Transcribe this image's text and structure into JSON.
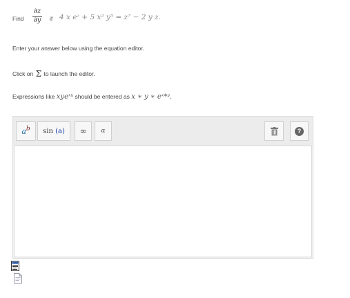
{
  "question": {
    "find_label": "Find",
    "derivative_numerator": "∂z",
    "derivative_denominator": "∂y",
    "if_label": "if",
    "equation": "4 x eᶻ + 5 x² y⁵ = z⁷ − 2 y z."
  },
  "instructions": {
    "line1": "Enter your answer below using the equation editor.",
    "line2_prefix": "Click on",
    "line2_symbol": "Σ",
    "line2_suffix": "to launch the editor.",
    "line3_prefix": "Expressions like",
    "line3_example": "xyeˣʸ",
    "line3_middle": "should be entered as",
    "line3_entry": "x ∗ y ∗ eˣ*ʸ."
  },
  "toolbar": {
    "power_base": "a",
    "power_exp": "b",
    "sin_label": "sin",
    "sin_arg": "(a)",
    "infinity_label": "∞",
    "alpha_label": "α",
    "help_label": "?"
  },
  "colors": {
    "toolbar_bg": "#ececec",
    "power_base_color": "#1a6fa8",
    "power_exp_color": "#7a1a1a",
    "sin_arg_color": "#1a3fa8"
  },
  "icons": [
    "trash-icon",
    "help-icon",
    "mathml-file-icon",
    "document-file-icon"
  ]
}
